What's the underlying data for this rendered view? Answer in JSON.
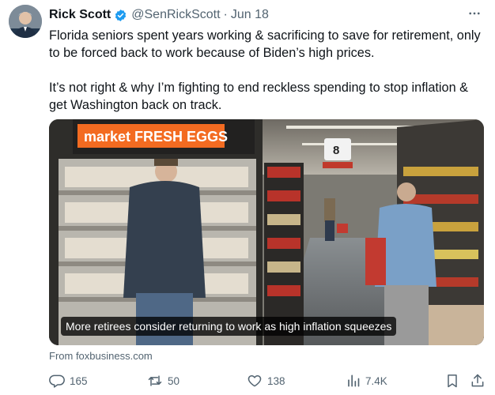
{
  "tweet": {
    "author_name": "Rick Scott",
    "handle": "@SenRickScott",
    "separator": "·",
    "date": "Jun 18",
    "paragraphs": [
      "Florida seniors spent years working & sacrificing to save for retirement, only to be forced back to work because of Biden’s high prices.",
      "It’s not right & why I’m fighting to end reckless spending to stop inflation & get Washington back on track."
    ]
  },
  "media": {
    "caption": "More retirees consider returning to work as high inflation squeezes",
    "store_sign": "market FRESH EGGS",
    "aisle_number": "8",
    "source": "From foxbusiness.com"
  },
  "actions": {
    "replies": "165",
    "reposts": "50",
    "likes": "138",
    "views": "7.4K"
  },
  "icons": {
    "verified": "verified-badge-icon",
    "more": "more-options-icon",
    "reply": "reply-icon",
    "repost": "repost-icon",
    "like": "like-icon",
    "views": "views-icon",
    "bookmark": "bookmark-icon",
    "share": "share-icon"
  },
  "colors": {
    "verified_blue": "#1d9bf0",
    "text_primary": "#0f1419",
    "text_secondary": "#536471",
    "sign_orange": "#f36b21"
  }
}
